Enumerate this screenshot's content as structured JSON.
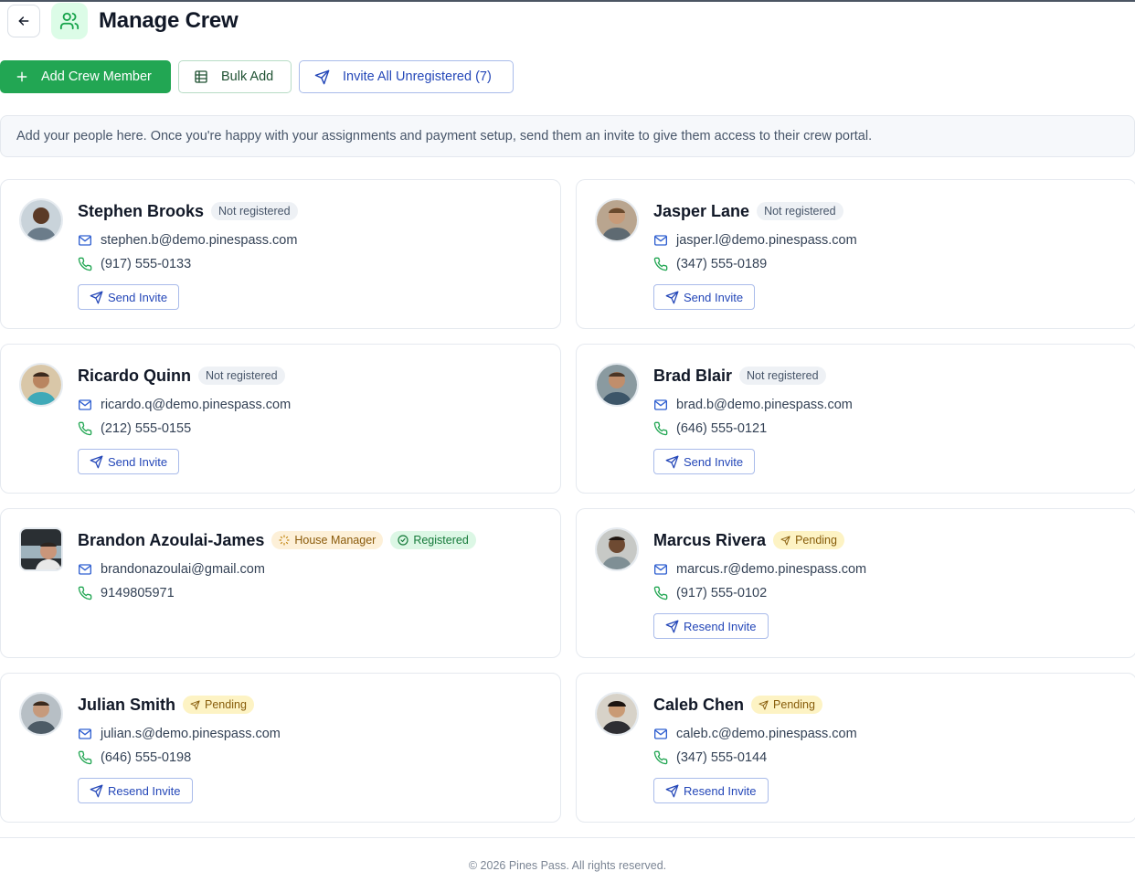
{
  "header": {
    "title": "Manage Crew",
    "back_icon": "arrow-left-icon",
    "title_icon": "users-icon"
  },
  "actions": {
    "add_label": "Add Crew Member",
    "bulk_label": "Bulk Add",
    "invite_all_label": "Invite All Unregistered (7)"
  },
  "banner": {
    "text": "Add your people here. Once you're happy with your assignments and payment setup, send them an invite to give them access to their crew portal."
  },
  "crew": [
    {
      "name": "Stephen Brooks",
      "email": "stephen.b@demo.pinespass.com",
      "phone": "(917) 555-0133",
      "status": "Not registered",
      "action": "Send Invite"
    },
    {
      "name": "Jasper Lane",
      "email": "jasper.l@demo.pinespass.com",
      "phone": "(347) 555-0189",
      "status": "Not registered",
      "action": "Send Invite"
    },
    {
      "name": "Ricardo Quinn",
      "email": "ricardo.q@demo.pinespass.com",
      "phone": "(212) 555-0155",
      "status": "Not registered",
      "action": "Send Invite"
    },
    {
      "name": "Brad Blair",
      "email": "brad.b@demo.pinespass.com",
      "phone": "(646) 555-0121",
      "status": "Not registered",
      "action": "Send Invite"
    },
    {
      "name": "Brandon Azoulai-James",
      "email": "brandonazoulai@gmail.com",
      "phone": "9149805971",
      "role": "House Manager",
      "status": "Registered"
    },
    {
      "name": "Marcus Rivera",
      "email": "marcus.r@demo.pinespass.com",
      "phone": "(917) 555-0102",
      "status": "Pending",
      "action": "Resend Invite"
    },
    {
      "name": "Julian Smith",
      "email": "julian.s@demo.pinespass.com",
      "phone": "(646) 555-0198",
      "status": "Pending",
      "action": "Resend Invite"
    },
    {
      "name": "Caleb Chen",
      "email": "caleb.c@demo.pinespass.com",
      "phone": "(347) 555-0144",
      "status": "Pending",
      "action": "Resend Invite"
    }
  ],
  "footer": {
    "text": "© 2026 Pines Pass. All rights reserved."
  },
  "colors": {
    "primary_green": "#22a653",
    "invite_blue": "#2447b8",
    "pending_bg": "#fdf3c4",
    "registered_bg": "#dcf7e5"
  }
}
